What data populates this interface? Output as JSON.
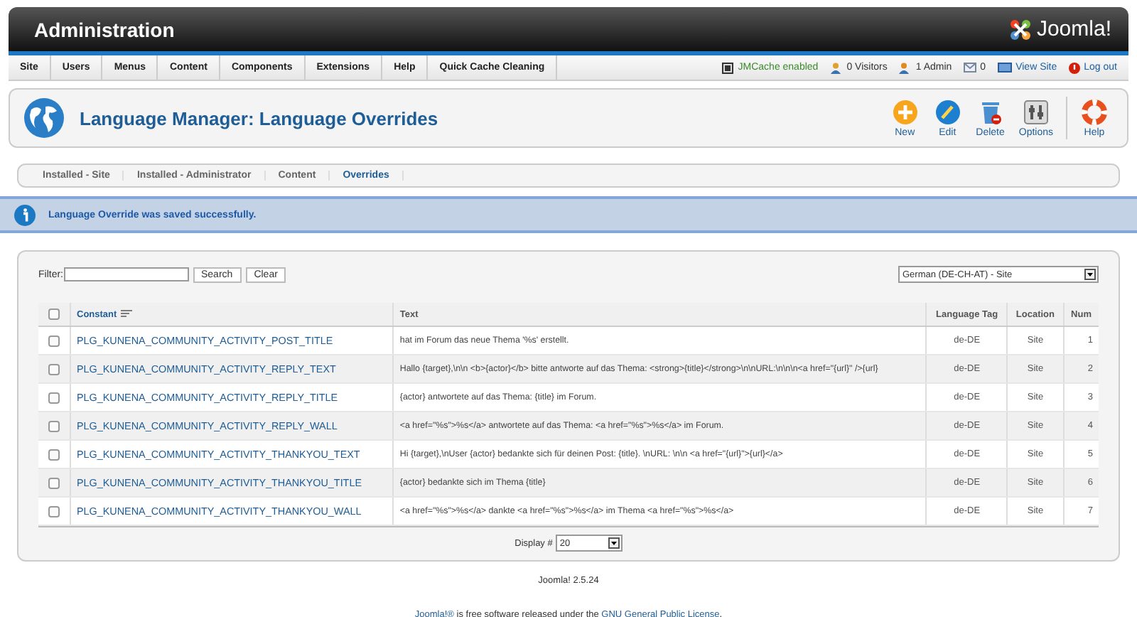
{
  "header": {
    "title": "Administration",
    "logo_text": "Joomla!"
  },
  "menu": {
    "items": [
      "Site",
      "Users",
      "Menus",
      "Content",
      "Components",
      "Extensions",
      "Help",
      "Quick Cache Cleaning"
    ],
    "status": [
      {
        "kind": "cache",
        "label": "JMCache enabled"
      },
      {
        "kind": "visitors",
        "label": "0 Visitors"
      },
      {
        "kind": "admin",
        "label": "1 Admin"
      },
      {
        "kind": "messages",
        "label": "0"
      },
      {
        "kind": "view",
        "label": "View Site"
      },
      {
        "kind": "logout",
        "label": "Log out"
      }
    ]
  },
  "toolbar": {
    "title": "Language Manager: Language Overrides",
    "buttons": [
      {
        "kind": "new",
        "label": "New"
      },
      {
        "kind": "edit",
        "label": "Edit"
      },
      {
        "kind": "delete",
        "label": "Delete"
      },
      {
        "kind": "options",
        "label": "Options"
      },
      {
        "kind": "help",
        "label": "Help"
      }
    ]
  },
  "tabs": [
    {
      "label": "Installed - Site",
      "selected": false
    },
    {
      "label": "Installed - Administrator",
      "selected": false
    },
    {
      "label": "Content",
      "selected": false
    },
    {
      "label": "Overrides",
      "selected": true
    }
  ],
  "message": "Language Override was saved successfully.",
  "filter": {
    "label": "Filter:",
    "search_button": "Search",
    "clear_button": "Clear",
    "language": "German (DE-CH-AT) - Site"
  },
  "table": {
    "select_all_checked": false,
    "columns": [
      "Constant",
      "Text",
      "Language Tag",
      "Location",
      "Num"
    ],
    "rows": [
      {
        "constant": "PLG_KUNENA_COMMUNITY_ACTIVITY_POST_TITLE",
        "text": "hat im Forum das neue Thema '%s' erstellt.",
        "tag": "de-DE",
        "location": "Site",
        "num": "1",
        "checked": false
      },
      {
        "constant": "PLG_KUNENA_COMMUNITY_ACTIVITY_REPLY_TEXT",
        "text": "Hallo {target},\\n\\n <b>{actor}</b> bitte antworte auf das Thema: <strong>{title}</strong>\\n\\nURL:\\n\\n\\n<a href=\"{url}\" />{url}",
        "tag": "de-DE",
        "location": "Site",
        "num": "2",
        "checked": false
      },
      {
        "constant": "PLG_KUNENA_COMMUNITY_ACTIVITY_REPLY_TITLE",
        "text": "{actor} antwortete auf das Thema: {title} im Forum.",
        "tag": "de-DE",
        "location": "Site",
        "num": "3",
        "checked": false
      },
      {
        "constant": "PLG_KUNENA_COMMUNITY_ACTIVITY_REPLY_WALL",
        "text": "<a href=\"%s\">%s</a> antwortete auf das Thema: <a href=\"%s\">%s</a> im Forum.",
        "tag": "de-DE",
        "location": "Site",
        "num": "4",
        "checked": false
      },
      {
        "constant": "PLG_KUNENA_COMMUNITY_ACTIVITY_THANKYOU_TEXT",
        "text": "Hi {target},\\nUser {actor} bedankte sich für deinen Post: {title}. \\nURL: \\n\\n <a href=\"{url}\">{url}</a>",
        "tag": "de-DE",
        "location": "Site",
        "num": "5",
        "checked": false
      },
      {
        "constant": "PLG_KUNENA_COMMUNITY_ACTIVITY_THANKYOU_TITLE",
        "text": "{actor} bedankte sich im Thema {title}",
        "tag": "de-DE",
        "location": "Site",
        "num": "6",
        "checked": false
      },
      {
        "constant": "PLG_KUNENA_COMMUNITY_ACTIVITY_THANKYOU_WALL",
        "text": "<a href=\"%s\">%s</a> dankte <a href=\"%s\">%s</a> im Thema <a href=\"%s\">%s</a>",
        "tag": "de-DE",
        "location": "Site",
        "num": "7",
        "checked": false
      }
    ]
  },
  "pagination": {
    "label": "Display #",
    "value": "20"
  },
  "footer": {
    "version": "Joomla! 2.5.24",
    "license_parts": [
      {
        "kind": "link",
        "text": "Joomla!®"
      },
      {
        "kind": "text",
        "text": " is free software released under the "
      },
      {
        "kind": "link",
        "text": "GNU General Public License"
      },
      {
        "kind": "text",
        "text": "."
      }
    ]
  }
}
